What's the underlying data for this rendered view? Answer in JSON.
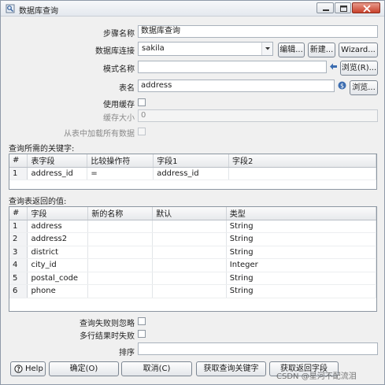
{
  "window": {
    "title": "数据库查询"
  },
  "form": {
    "step_name_label": "步骤名称",
    "step_name_value": "数据库查询",
    "connection_label": "数据库连接",
    "connection_value": "sakila",
    "edit_button": "编辑...",
    "new_button": "新建...",
    "wizard_button": "Wizard...",
    "schema_label": "模式名称",
    "schema_value": "",
    "browse_schema_button": "浏览(R)...",
    "table_label": "表名",
    "table_value": "address",
    "browse_table_button": "浏览...",
    "cache_label": "使用缓存",
    "cache_size_label": "缓存大小",
    "cache_size_value": "0",
    "load_all_label": "从表中加载所有数据"
  },
  "keys": {
    "section_label": "查询所需的关键字:",
    "columns": [
      "#",
      "表字段",
      "比较操作符",
      "字段1",
      "字段2"
    ],
    "rows": [
      [
        "1",
        "address_id",
        "=",
        "address_id",
        ""
      ]
    ]
  },
  "returns": {
    "section_label": "查询表返回的值:",
    "columns": [
      "#",
      "字段",
      "新的名称",
      "默认",
      "类型"
    ],
    "rows": [
      [
        "1",
        "address",
        "",
        "",
        "String"
      ],
      [
        "2",
        "address2",
        "",
        "",
        "String"
      ],
      [
        "3",
        "district",
        "",
        "",
        "String"
      ],
      [
        "4",
        "city_id",
        "",
        "",
        "Integer"
      ],
      [
        "5",
        "postal_code",
        "",
        "",
        "String"
      ],
      [
        "6",
        "phone",
        "",
        "",
        "String"
      ]
    ]
  },
  "options": {
    "ignore_fail_label": "查询失败则忽略",
    "multi_fail_label": "多行结果时失败",
    "order_label": "排序",
    "order_value": ""
  },
  "buttons": {
    "help": "Help",
    "ok": "确定(O)",
    "cancel": "取消(C)",
    "get_keys": "获取查询关键字",
    "get_returns": "获取返回字段"
  },
  "watermark": "CSDN @星河不配流泪"
}
